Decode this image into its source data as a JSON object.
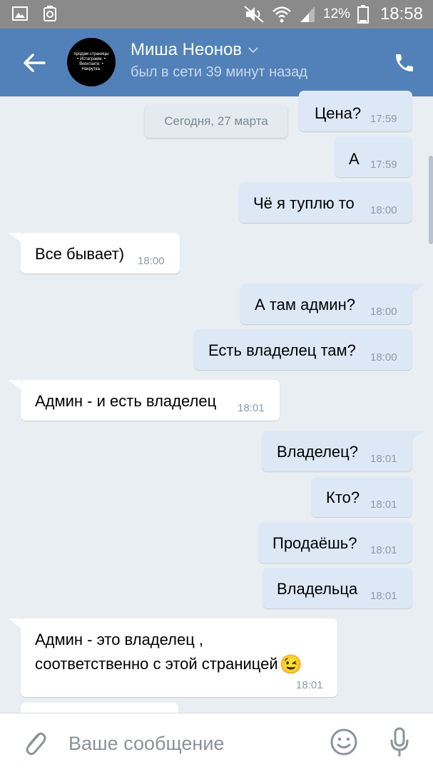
{
  "status_bar": {
    "battery": "12%",
    "time": "18:58",
    "left_icons": [
      "gallery-icon",
      "recycle-icon"
    ],
    "right_icons": [
      "mute-icon",
      "wifi-icon",
      "signal-icon",
      "battery-icon"
    ]
  },
  "header": {
    "name": "Миша Неонов",
    "status": "был в сети 39 минут назад",
    "avatar_text": "продам страницы • Истаграмм. • Вконтакте. • Накрутка.",
    "back_icon": "arrow-left-icon",
    "call_icon": "phone-icon"
  },
  "date_separator": "Сегодня, 27 марта",
  "messages": [
    {
      "dir": "out",
      "text": "Цена?",
      "time": "17:59"
    },
    {
      "dir": "out",
      "text": "А",
      "time": "17:59"
    },
    {
      "dir": "out",
      "text": "Чё я туплю то",
      "time": "18:00"
    },
    {
      "dir": "in",
      "text": "Все бывает)",
      "time": "18:00"
    },
    {
      "dir": "out",
      "text": "А там админ?",
      "time": "18:00"
    },
    {
      "dir": "out",
      "text": "Есть владелец там?",
      "time": "18:00"
    },
    {
      "dir": "in",
      "text": "Админ - и есть владелец",
      "time": "18:01"
    },
    {
      "dir": "out",
      "text": "Владелец?",
      "time": "18:01"
    },
    {
      "dir": "out",
      "text": "Кто?",
      "time": "18:01"
    },
    {
      "dir": "out",
      "text": "Продаёшь?",
      "time": "18:01"
    },
    {
      "dir": "out",
      "text": "Владельца",
      "time": "18:01"
    },
    {
      "dir": "in",
      "line1": "Админ - это владелец ,",
      "line2": "соответственно с этой страницей",
      "emoji": "😉",
      "time": "18:01"
    }
  ],
  "composer": {
    "placeholder": "Ваше сообщение",
    "value": "",
    "attach_icon": "paperclip-icon",
    "emoji_icon": "emoji-icon",
    "mic_icon": "microphone-icon"
  },
  "colors": {
    "header_bg": "#5181b8",
    "status_bar_bg": "#8a8a8a",
    "chat_bg": "#e9eef3",
    "outgoing_bubble": "#dde8f6",
    "incoming_bubble": "#ffffff"
  }
}
